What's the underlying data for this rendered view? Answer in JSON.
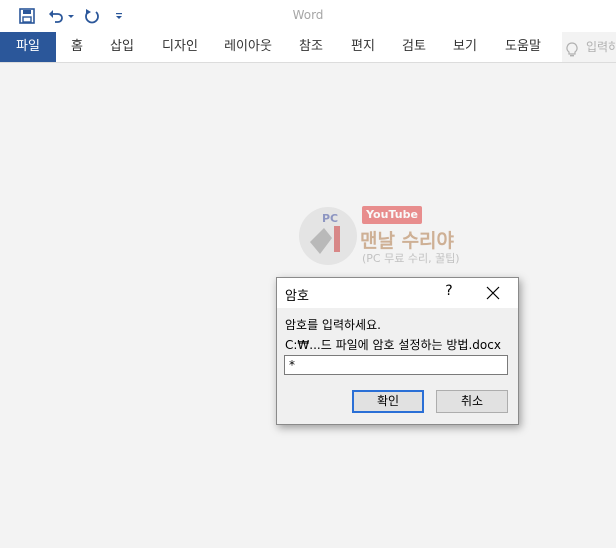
{
  "app": {
    "window_title": "Word"
  },
  "quick_access": {
    "icons": [
      "save-icon",
      "undo-icon",
      "undo-dropdown-icon",
      "redo-icon",
      "customize-qat-icon"
    ]
  },
  "ribbon": {
    "tabs": [
      {
        "label": "파일",
        "active": true
      },
      {
        "label": "홈"
      },
      {
        "label": "삽입"
      },
      {
        "label": "디자인"
      },
      {
        "label": "레이아웃"
      },
      {
        "label": "참조"
      },
      {
        "label": "편지"
      },
      {
        "label": "검토"
      },
      {
        "label": "보기"
      },
      {
        "label": "도움말"
      }
    ],
    "tell_me_placeholder": "입력하"
  },
  "watermark": {
    "badge": "YouTube",
    "logo_text": "PC",
    "channel_name": "맨날 수리야",
    "subtitle": "(PC 무료 수리, 꿀팁)"
  },
  "dialog": {
    "title": "암호",
    "help_label": "?",
    "prompt": "암호를 입력하세요.",
    "file_path": "C:₩...드 파일에 암호 설정하는 방법.docx",
    "password_value": "*",
    "ok_label": "확인",
    "cancel_label": "취소"
  },
  "colors": {
    "accent": "#2b579a",
    "ok_focus": "#2a6fd6"
  }
}
